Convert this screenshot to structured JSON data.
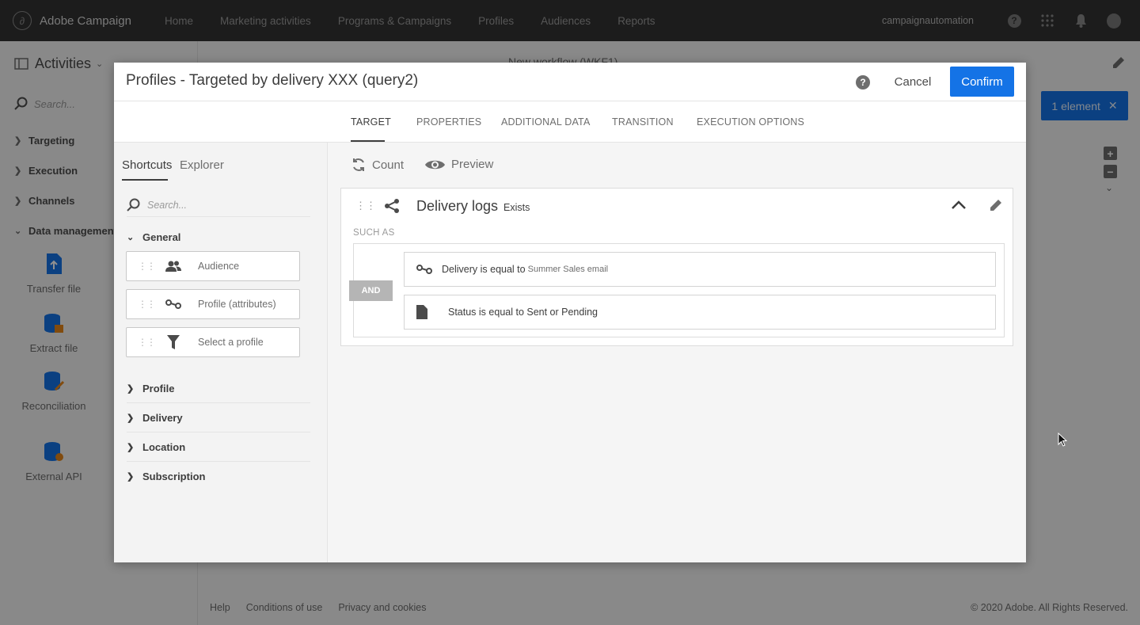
{
  "topnav": {
    "brand": "Adobe Campaign",
    "links": [
      "Home",
      "Marketing activities",
      "Programs & Campaigns",
      "Profiles",
      "Audiences",
      "Reports"
    ],
    "user": "campaignautomation",
    "icons": [
      "help-icon",
      "apps-grid-icon",
      "bell-icon",
      "avatar-icon"
    ]
  },
  "activities_panel": {
    "title": "Activities",
    "search_placeholder": "Search...",
    "categories": [
      "Targeting",
      "Execution",
      "Channels",
      "Data management ("
    ],
    "tools": [
      "Transfer file",
      "Extract file",
      "Reconciliation",
      "External API"
    ]
  },
  "workflow": {
    "title": "New workflow (WKF1)",
    "selection_label": "1 element"
  },
  "footer": {
    "links": [
      "Help",
      "Conditions of use",
      "Privacy and cookies"
    ],
    "copyright": "© 2020 Adobe. All Rights Reserved."
  },
  "modal": {
    "title": "Profiles - Targeted by delivery XXX (query2)",
    "cancel_label": "Cancel",
    "confirm_label": "Confirm",
    "tabs": [
      "TARGET",
      "PROPERTIES",
      "ADDITIONAL DATA",
      "TRANSITION",
      "EXECUTION OPTIONS"
    ],
    "active_tab": "TARGET",
    "palette": {
      "tabs": [
        "Shortcuts",
        "Explorer"
      ],
      "search_placeholder": "Search...",
      "general_label": "General",
      "shortcuts": [
        "Audience",
        "Profile (attributes)",
        "Select a profile"
      ],
      "sections": [
        "Profile",
        "Delivery",
        "Location",
        "Subscription"
      ]
    },
    "workspace": {
      "count_label": "Count",
      "preview_label": "Preview",
      "condition": {
        "title": "Delivery logs",
        "operator": "Exists",
        "such_as": "SUCH AS",
        "logic": "AND",
        "rules": [
          {
            "text": "Delivery is equal to",
            "value": "Summer Sales email"
          },
          {
            "text": "Status is equal to Sent or Pending",
            "value": ""
          }
        ]
      }
    }
  },
  "colors": {
    "accent": "#1473e6",
    "topbar": "#323232"
  }
}
